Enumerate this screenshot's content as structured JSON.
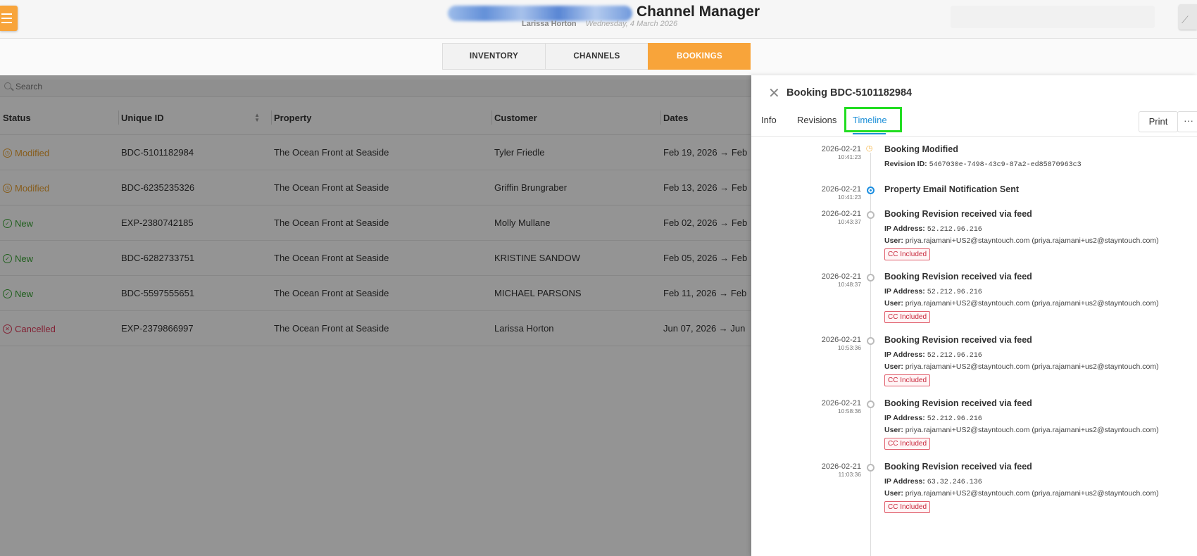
{
  "header": {
    "app_title": "Channel Manager",
    "user_name": "Larissa Horton",
    "date": "Wednesday, 4 March 2026"
  },
  "nav": {
    "tabs": [
      {
        "label": "INVENTORY"
      },
      {
        "label": "CHANNELS"
      },
      {
        "label": "BOOKINGS",
        "active": true
      }
    ]
  },
  "search": {
    "placeholder": "Search"
  },
  "table": {
    "columns": [
      "Status",
      "Unique ID",
      "Property",
      "Customer",
      "Dates"
    ],
    "rows": [
      {
        "status": "Modified",
        "status_type": "modified",
        "id": "BDC-5101182984",
        "property": "The Ocean Front at Seaside",
        "customer": "Tyler Friedle",
        "dates": "Feb 19, 2026  →  Feb"
      },
      {
        "status": "Modified",
        "status_type": "modified",
        "id": "BDC-6235235326",
        "property": "The Ocean Front at Seaside",
        "customer": "Griffin Brungraber",
        "dates": "Feb 13, 2026  →  Feb"
      },
      {
        "status": "New",
        "status_type": "new",
        "id": "EXP-2380742185",
        "property": "The Ocean Front at Seaside",
        "customer": "Molly Mullane",
        "dates": "Feb 02, 2026  →  Feb"
      },
      {
        "status": "New",
        "status_type": "new",
        "id": "BDC-6282733751",
        "property": "The Ocean Front at Seaside",
        "customer": "KRISTINE SANDOW",
        "dates": "Feb 05, 2026  →  Feb"
      },
      {
        "status": "New",
        "status_type": "new",
        "id": "BDC-5597555651",
        "property": "The Ocean Front at Seaside",
        "customer": "MICHAEL PARSONS",
        "dates": "Feb 11, 2026  →  Feb"
      },
      {
        "status": "Cancelled",
        "status_type": "cancelled",
        "id": "EXP-2379866997",
        "property": "The Ocean Front at Seaside",
        "customer": "Larissa Horton",
        "dates": "Jun 07, 2026  →  Jun"
      }
    ]
  },
  "panel": {
    "title": "Booking BDC-5101182984",
    "tabs": {
      "info": "Info",
      "revisions": "Revisions",
      "timeline": "Timeline"
    },
    "print_label": "Print",
    "more_label": "···",
    "events": [
      {
        "date": "2026-02-21",
        "time": "10:41:23",
        "title": "Booking Modified",
        "icon": "clock-icon",
        "revision_label": "Revision ID:",
        "revision_id": "5467030e-7498-43c9-87a2-ed85870963c3"
      },
      {
        "date": "2026-02-21",
        "time": "10:41:23",
        "title": "Property Email Notification Sent",
        "icon": "dot-icon"
      },
      {
        "date": "2026-02-21",
        "time": "10:43:37",
        "title": "Booking Revision received via feed",
        "icon": "dot-icon",
        "ip_label": "IP Address:",
        "ip": "52.212.96.216",
        "user_label": "User:",
        "user": "priya.rajamani+US2@stayntouch.com (priya.rajamani+us2@stayntouch.com)",
        "badge": "CC Included"
      },
      {
        "date": "2026-02-21",
        "time": "10:48:37",
        "title": "Booking Revision received via feed",
        "icon": "dot-icon",
        "ip_label": "IP Address:",
        "ip": "52.212.96.216",
        "user_label": "User:",
        "user": "priya.rajamani+US2@stayntouch.com (priya.rajamani+us2@stayntouch.com)",
        "badge": "CC Included"
      },
      {
        "date": "2026-02-21",
        "time": "10:53:36",
        "title": "Booking Revision received via feed",
        "icon": "dot-icon",
        "ip_label": "IP Address:",
        "ip": "52.212.96.216",
        "user_label": "User:",
        "user": "priya.rajamani+US2@stayntouch.com (priya.rajamani+us2@stayntouch.com)",
        "badge": "CC Included"
      },
      {
        "date": "2026-02-21",
        "time": "10:58:36",
        "title": "Booking Revision received via feed",
        "icon": "dot-icon",
        "ip_label": "IP Address:",
        "ip": "52.212.96.216",
        "user_label": "User:",
        "user": "priya.rajamani+US2@stayntouch.com (priya.rajamani+us2@stayntouch.com)",
        "badge": "CC Included"
      },
      {
        "date": "2026-02-21",
        "time": "11:03:36",
        "title": "Booking Revision received via feed",
        "icon": "dot-icon",
        "ip_label": "IP Address:",
        "ip": "63.32.246.136",
        "user_label": "User:",
        "user": "priya.rajamani+US2@stayntouch.com (priya.rajamani+us2@stayntouch.com)",
        "badge": "CC Included"
      }
    ]
  },
  "colors": {
    "accent": "#f8a43a",
    "link": "#1e90d8",
    "modified": "#e8a030",
    "new": "#3aa535",
    "cancelled": "#e03a5a",
    "highlight": "#22dd22"
  }
}
